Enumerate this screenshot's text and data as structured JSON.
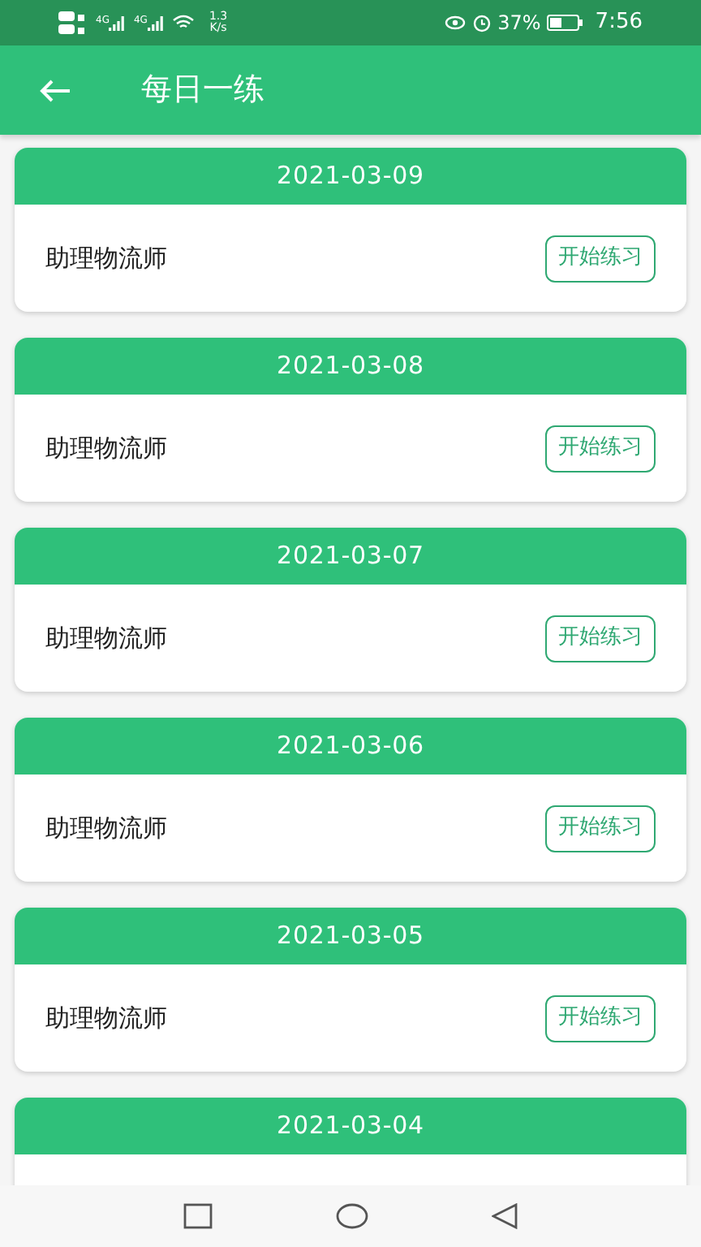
{
  "status_bar": {
    "network_labels": [
      "4G",
      "4G"
    ],
    "speed_value": "1.3",
    "speed_unit": "K/s",
    "battery_percent": "37%",
    "time": "7:56"
  },
  "app_bar": {
    "title": "每日一练"
  },
  "practices": [
    {
      "date": "2021-03-09",
      "title": "助理物流师",
      "button": "开始练习"
    },
    {
      "date": "2021-03-08",
      "title": "助理物流师",
      "button": "开始练习"
    },
    {
      "date": "2021-03-07",
      "title": "助理物流师",
      "button": "开始练习"
    },
    {
      "date": "2021-03-06",
      "title": "助理物流师",
      "button": "开始练习"
    },
    {
      "date": "2021-03-05",
      "title": "助理物流师",
      "button": "开始练习"
    },
    {
      "date": "2021-03-04"
    }
  ]
}
